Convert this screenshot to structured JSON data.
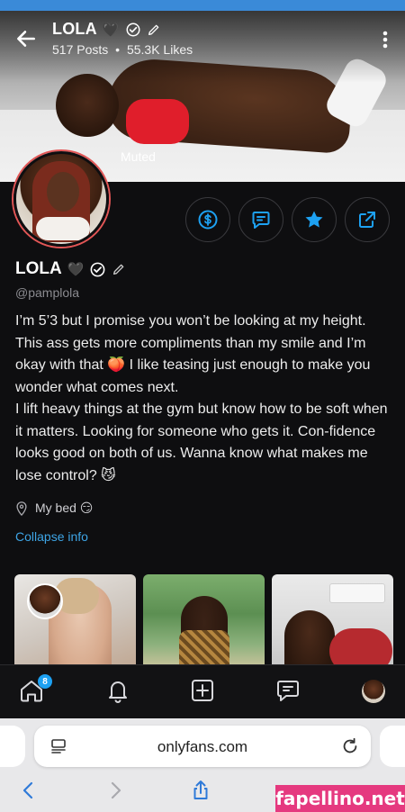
{
  "profile": {
    "header_name": "LOLA",
    "header_heart": "🖤",
    "posts": "517 Posts",
    "separator": "•",
    "likes": "55.3K Likes",
    "muted_label": "Muted",
    "name": "LOLA",
    "name_heart": "🖤",
    "handle": "@pamplola",
    "bio": "I’m 5’3 but I promise you won’t be looking at my height. This ass gets more compliments than my smile and I’m okay with that 🍑 I like teasing just enough to make you wonder what comes next.\nI lift heavy things at the gym but know how to be soft when it matters. Looking for someone who gets it. Con-fidence looks good on both of us. Wanna know what makes me lose control? 😼",
    "location": "My bed 😏",
    "collapse_label": "Collapse info"
  },
  "actions": [
    {
      "icon": "dollar-icon"
    },
    {
      "icon": "message-icon"
    },
    {
      "icon": "star-icon"
    },
    {
      "icon": "share-icon"
    }
  ],
  "bottom_nav": {
    "home_badge": "8",
    "items": [
      "home-icon",
      "bell-icon",
      "add-post-icon",
      "chat-icon",
      "profile-avatar"
    ]
  },
  "browser": {
    "url": "onlyfans.com"
  },
  "watermark": "fapellino.net",
  "colors": {
    "accent": "#1da1f2",
    "link": "#3ea5e6",
    "background": "#0e0e10",
    "avatar_ring": "#e25656",
    "watermark_bg": "#e5397f"
  }
}
